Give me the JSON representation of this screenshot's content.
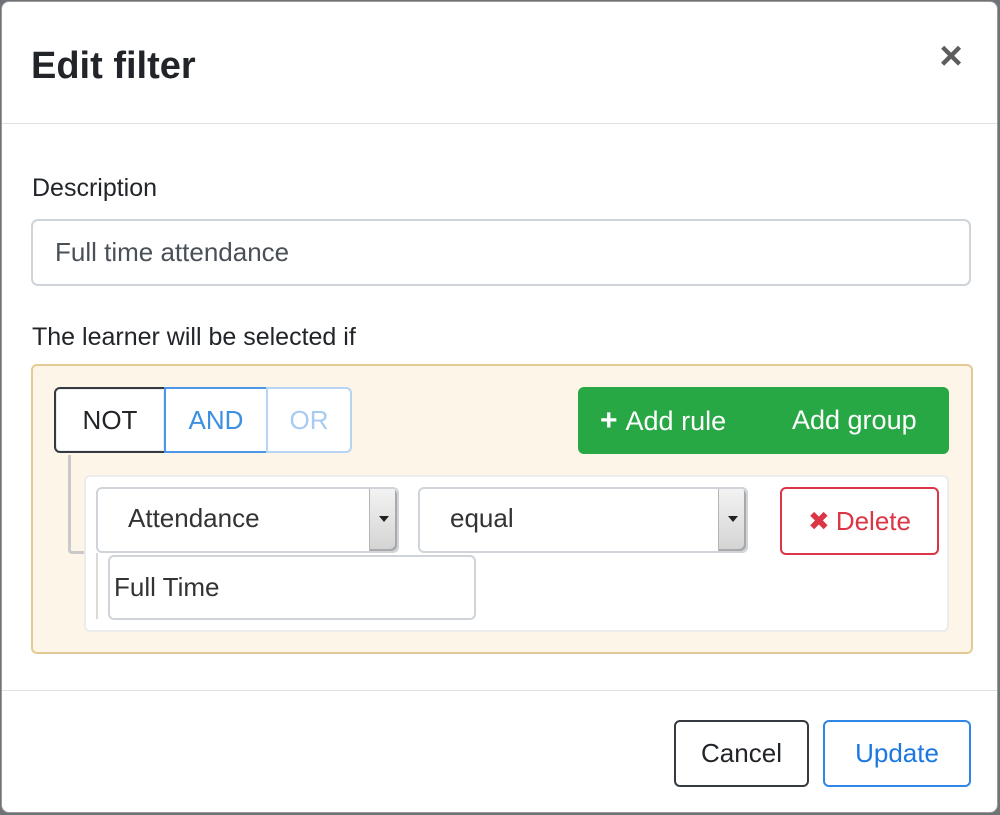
{
  "modal": {
    "title": "Edit filter",
    "close_glyph": "×"
  },
  "description": {
    "label": "Description",
    "value": "Full time attendance"
  },
  "query_builder": {
    "intro_label": "The learner will be selected if",
    "conditions": {
      "not_label": "NOT",
      "and_label": "AND",
      "or_label": "OR"
    },
    "actions": {
      "plus_icon": "+",
      "add_rule_label": "Add rule",
      "add_group_label": "Add group"
    },
    "rule": {
      "field_value": "Attendance",
      "operator_value": "equal",
      "delete_icon": "✖",
      "delete_label": "Delete",
      "value": "Full Time"
    }
  },
  "footer": {
    "cancel_label": "Cancel",
    "update_label": "Update"
  },
  "colors": {
    "success": "#28a745",
    "danger": "#dc3545",
    "primary": "#1a78e0",
    "group_bg": "#fcf5e8",
    "group_border": "#e3ca94"
  }
}
